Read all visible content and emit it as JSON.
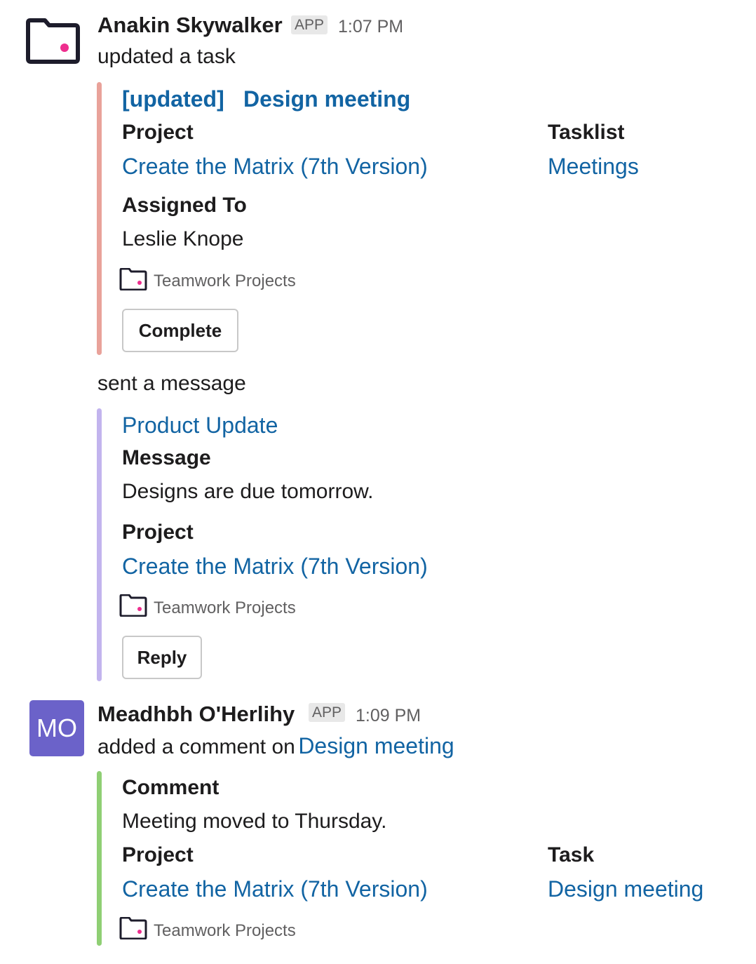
{
  "colors": {
    "bar_task": "#e9a29a",
    "bar_message": "#c2b4ee",
    "bar_comment": "#8fcf74",
    "link": "#1264a3",
    "avatar_mo": "#6b62c9",
    "logo_dot": "#ee2e8e"
  },
  "messages": [
    {
      "avatar_icon": "teamwork-folder-icon",
      "author": "Anakin Skywalker",
      "badge": "APP",
      "time": "1:07 PM",
      "action": "updated a task",
      "task_card": {
        "tag": "[updated]",
        "title": "Design meeting",
        "project_label": "Project",
        "project_value": "Create the Matrix (7th Version)",
        "tasklist_label": "Tasklist",
        "tasklist_value": "Meetings",
        "assigned_label": "Assigned To",
        "assigned_value": "Leslie Knope",
        "footer_icon": "teamwork-folder-icon",
        "footer": "Teamwork Projects",
        "button": "Complete"
      },
      "action2": "sent a message",
      "message_card": {
        "title": "Product Update",
        "message_label": "Message",
        "message_value": "Designs are due tomorrow.",
        "project_label": "Project",
        "project_value": "Create the Matrix (7th Version)",
        "footer_icon": "teamwork-folder-icon",
        "footer": "Teamwork Projects",
        "button": "Reply"
      }
    },
    {
      "avatar_initials": "MO",
      "author": "Meadhbh O'Herlihy",
      "badge": "APP",
      "time": "1:09 PM",
      "action_prefix": "added a comment on",
      "action_link": "Design meeting",
      "comment_card": {
        "comment_label": "Comment",
        "comment_value": "Meeting moved to Thursday.",
        "project_label": "Project",
        "project_value": "Create the Matrix (7th Version)",
        "task_label": "Task",
        "task_value": "Design meeting",
        "footer_icon": "teamwork-folder-icon",
        "footer": "Teamwork Projects"
      }
    }
  ]
}
